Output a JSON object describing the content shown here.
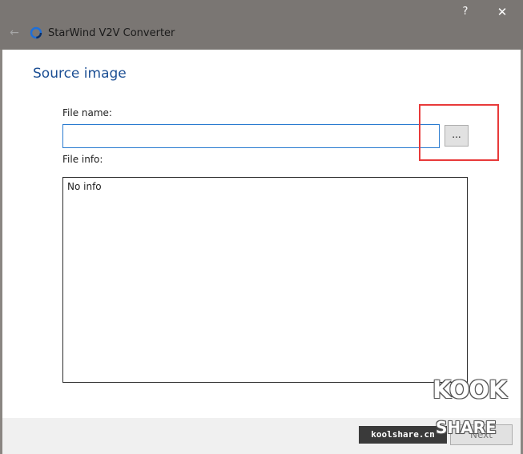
{
  "window": {
    "title": "StarWind V2V Converter",
    "help": "?",
    "close": "✕",
    "back": "←"
  },
  "page": {
    "section_title": "Source image"
  },
  "file_name": {
    "label": "File name:",
    "value": "",
    "browse_label": "..."
  },
  "file_info": {
    "label": "File info:",
    "content": "No info"
  },
  "footer": {
    "watermark_text": "koolshare.cn",
    "next_label": "Next"
  },
  "watermark_logo": {
    "top_text": "KOOK",
    "bottom_text": "SHARE"
  },
  "colors": {
    "titlebar": "#7a7673",
    "accent": "#1c4f94",
    "input_border": "#2a7bd0",
    "highlight": "#e83a3a"
  }
}
